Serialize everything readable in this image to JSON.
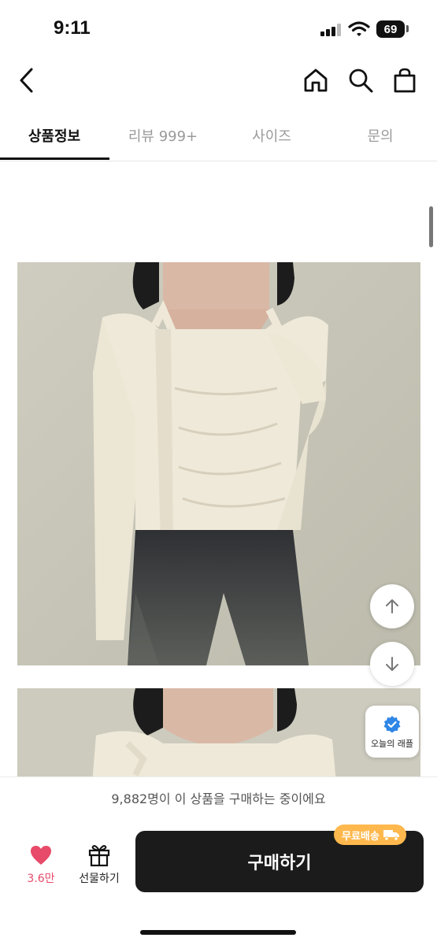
{
  "status_bar": {
    "time": "9:11",
    "battery": "69"
  },
  "tabs": [
    {
      "label": "상품정보",
      "active": true
    },
    {
      "label": "리뷰 999+",
      "active": false
    },
    {
      "label": "사이즈",
      "active": false
    },
    {
      "label": "문의",
      "active": false
    }
  ],
  "raffle": {
    "label": "오늘의 래플"
  },
  "purchase_notice": "9,882명이 이 상품을 구매하는 중이에요",
  "bottom_bar": {
    "like_count": "3.6만",
    "gift_label": "선물하기",
    "buy_label": "구매하기",
    "shipping_badge": "무료배송"
  },
  "colors": {
    "accent_pink": "#e84a6a",
    "buy_button": "#1b1b1b",
    "shipping_badge": "#ffb84d",
    "raffle_badge": "#2f86e6"
  },
  "icons": [
    "back-icon",
    "home-icon",
    "search-icon",
    "shopping-bag-icon",
    "arrow-up-icon",
    "arrow-down-icon",
    "verified-badge-icon",
    "heart-icon",
    "gift-icon",
    "truck-icon"
  ]
}
